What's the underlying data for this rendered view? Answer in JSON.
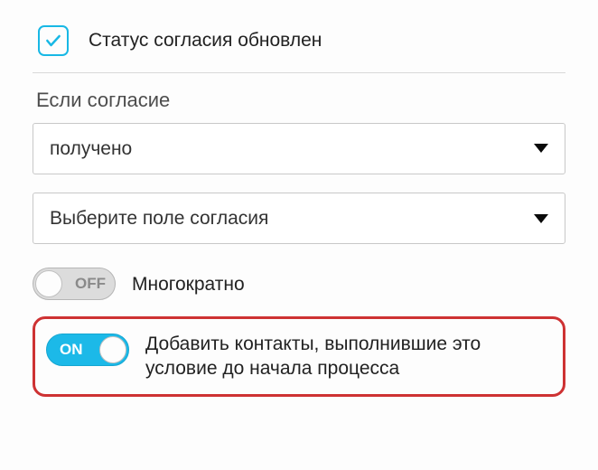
{
  "checkbox": {
    "label": "Статус согласия обновлен",
    "checked": true
  },
  "section_label": "Если согласие",
  "select_consent": {
    "value": "получено"
  },
  "select_field": {
    "value": "Выберите поле согласия"
  },
  "toggle_multiple": {
    "state": "OFF",
    "label": "Многократно"
  },
  "toggle_add_contacts": {
    "state": "ON",
    "label": "Добавить контакты, выполнившие это условие до начала процесса"
  }
}
